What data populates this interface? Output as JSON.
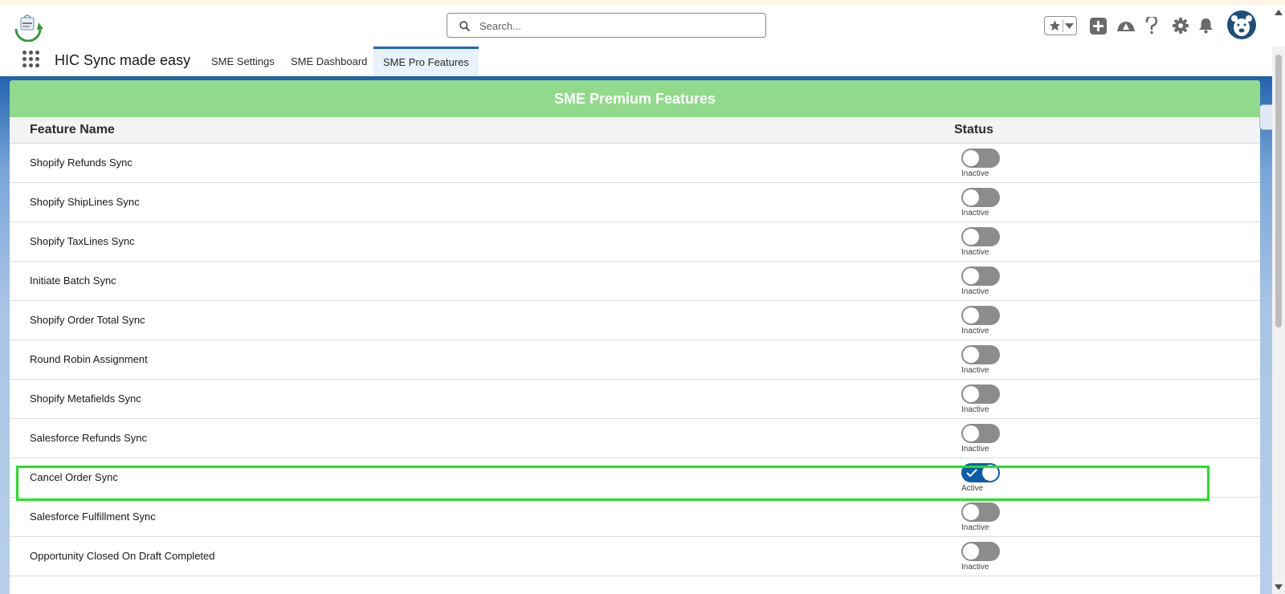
{
  "header": {
    "search_placeholder": "Search...",
    "icons": [
      "favorites-star-icon",
      "favorites-dropdown-icon",
      "add-icon",
      "trailhead-icon",
      "help-icon",
      "settings-gear-icon",
      "notification-bell-icon",
      "user-avatar"
    ]
  },
  "nav": {
    "app_name": "HIC Sync made easy",
    "tabs": [
      {
        "label": "SME Settings",
        "active": false
      },
      {
        "label": "SME Dashboard",
        "active": false
      },
      {
        "label": "SME Pro Features",
        "active": true
      }
    ]
  },
  "card": {
    "title": "SME Premium Features",
    "col_feature": "Feature Name",
    "col_status": "Status",
    "rows": [
      {
        "name": "Shopify Refunds Sync",
        "status": "Inactive",
        "on": false
      },
      {
        "name": "Shopify ShipLines Sync",
        "status": "Inactive",
        "on": false
      },
      {
        "name": "Shopify TaxLines Sync",
        "status": "Inactive",
        "on": false
      },
      {
        "name": "Initiate Batch Sync",
        "status": "Inactive",
        "on": false
      },
      {
        "name": "Shopify Order Total Sync",
        "status": "Inactive",
        "on": false
      },
      {
        "name": "Round Robin Assignment",
        "status": "Inactive",
        "on": false
      },
      {
        "name": "Shopify Metafields Sync",
        "status": "Inactive",
        "on": false
      },
      {
        "name": "Salesforce Refunds Sync",
        "status": "Inactive",
        "on": false
      },
      {
        "name": "Cancel Order Sync",
        "status": "Active",
        "on": true
      },
      {
        "name": "Salesforce Fulfillment Sync",
        "status": "Inactive",
        "on": false
      },
      {
        "name": "Opportunity Closed On Draft Completed",
        "status": "Inactive",
        "on": false
      }
    ]
  },
  "colors": {
    "title_bar": "#92da8b",
    "toggle_on": "#0b5cab",
    "toggle_off": "#8c8c8c",
    "highlight": "#22e122",
    "nav_accent": "#1f5fa8"
  }
}
